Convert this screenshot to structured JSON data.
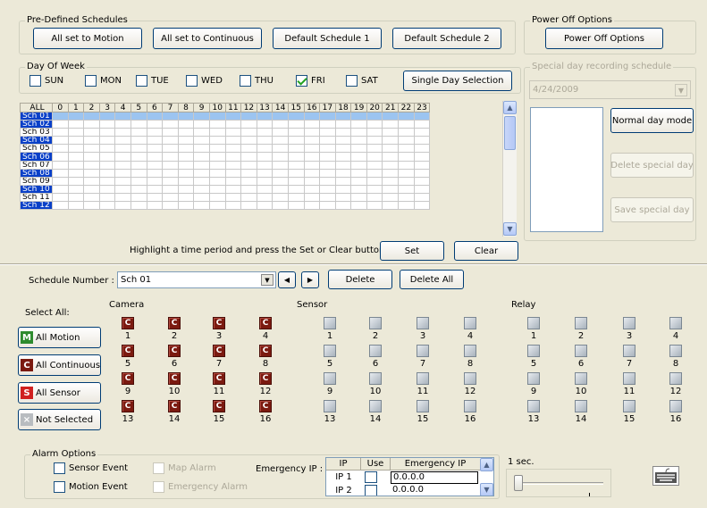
{
  "predefined": {
    "legend": "Pre-Defined Schedules",
    "buttons": [
      "All set to Motion",
      "All set to Continuous",
      "Default Schedule 1",
      "Default Schedule 2"
    ]
  },
  "poweroff": {
    "legend": "Power Off Options",
    "button": "Power Off Options"
  },
  "dayofweek": {
    "legend": "Day Of Week",
    "days": [
      {
        "label": "SUN",
        "checked": false
      },
      {
        "label": "MON",
        "checked": false
      },
      {
        "label": "TUE",
        "checked": false
      },
      {
        "label": "WED",
        "checked": false
      },
      {
        "label": "THU",
        "checked": false
      },
      {
        "label": "FRI",
        "checked": true
      },
      {
        "label": "SAT",
        "checked": false
      }
    ],
    "single_button": "Single Day Selection"
  },
  "special": {
    "legend": "Special day recording schedule",
    "date": "4/24/2009",
    "normal_button": "Normal day mode",
    "delete_button": "Delete special day",
    "save_button": "Save special day"
  },
  "grid": {
    "corner": "ALL",
    "hours": [
      "0",
      "1",
      "2",
      "3",
      "4",
      "5",
      "6",
      "7",
      "8",
      "9",
      "10",
      "11",
      "12",
      "13",
      "14",
      "15",
      "16",
      "17",
      "18",
      "19",
      "20",
      "21",
      "22",
      "23"
    ],
    "rows": [
      "Sch 01",
      "Sch 02",
      "Sch 03",
      "Sch 04",
      "Sch 05",
      "Sch 06",
      "Sch 07",
      "Sch 08",
      "Sch 09",
      "Sch 10",
      "Sch 11",
      "Sch 12"
    ]
  },
  "hint": "Highlight a time period and press the Set or Clear button",
  "set_button": "Set",
  "clear_button": "Clear",
  "schedule": {
    "label": "Schedule Number :",
    "value": "Sch 01",
    "delete": "Delete",
    "delete_all": "Delete All"
  },
  "select_all": {
    "label": "Select All:",
    "buttons": [
      {
        "icon": "M",
        "label": "All Motion",
        "color": "#2e8b2e"
      },
      {
        "icon": "C",
        "label": "All Continuous",
        "color": "#7b1a10"
      },
      {
        "icon": "S",
        "label": "All Sensor",
        "color": "#d02020"
      },
      {
        "icon": "×",
        "label": "Not Selected",
        "color": "#b8bcc0"
      }
    ]
  },
  "sections": {
    "camera": "Camera",
    "sensor": "Sensor",
    "relay": "Relay"
  },
  "cam_icon": "C",
  "numbers": [
    "1",
    "2",
    "3",
    "4",
    "5",
    "6",
    "7",
    "8",
    "9",
    "10",
    "11",
    "12",
    "13",
    "14",
    "15",
    "16"
  ],
  "alarm": {
    "legend": "Alarm Options",
    "sensor_event": "Sensor Event",
    "motion_event": "Motion Event",
    "map_alarm": "Map Alarm",
    "emergency_alarm": "Emergency Alarm"
  },
  "emergency": {
    "label": "Emergency IP :",
    "cols": [
      "IP",
      "Use",
      "Emergency IP"
    ],
    "rows": [
      {
        "ip": "IP 1",
        "value": "0.0.0.0"
      },
      {
        "ip": "IP 2",
        "value": "0.0.0.0"
      }
    ]
  },
  "slider_label": "1 sec."
}
